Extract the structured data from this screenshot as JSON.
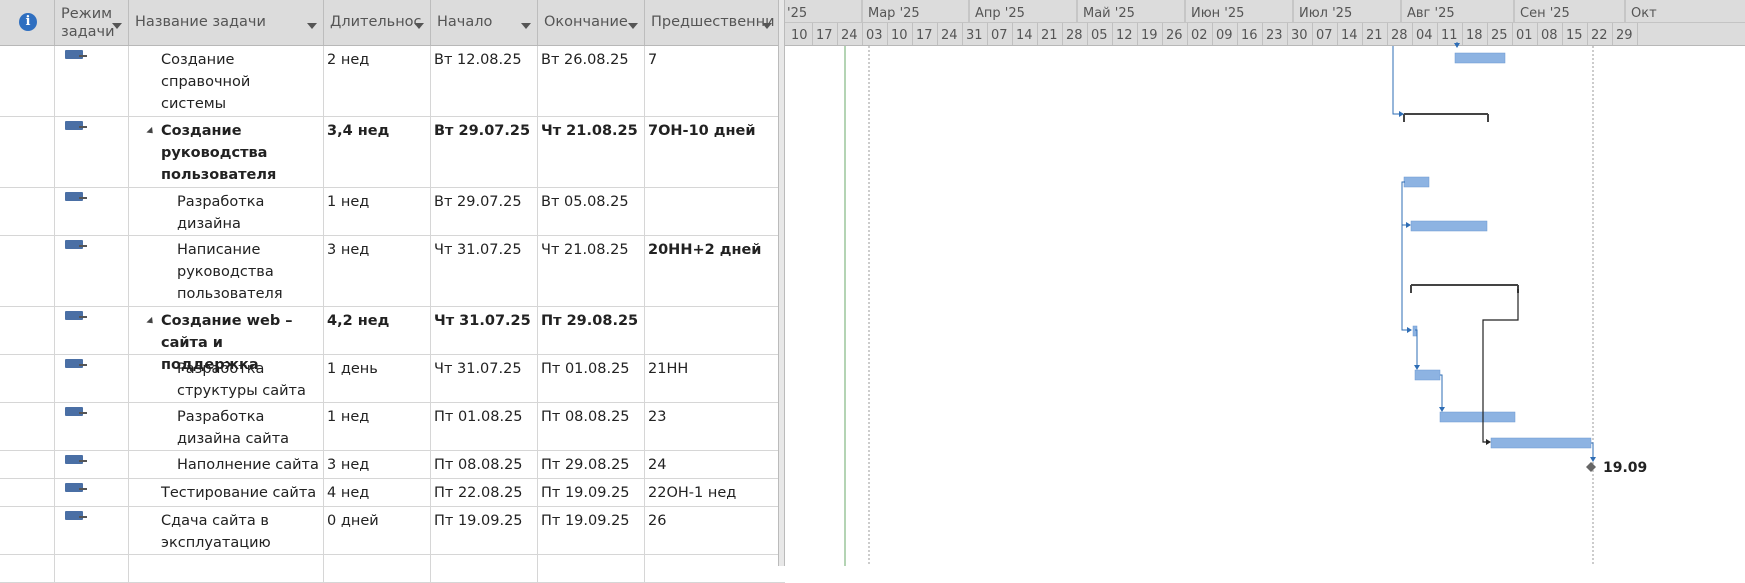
{
  "header": {
    "info_icon": "i",
    "mode_label_1": "Режим",
    "mode_label_2": "задачи",
    "name_label": "Название задачи",
    "duration_label": "Длительнос",
    "start_label": "Начало",
    "finish_label": "Окончание",
    "pred_label": "Предшественни"
  },
  "timeline": {
    "months": [
      "'25",
      "Мар '25",
      "Апр '25",
      "Май '25",
      "Июн '25",
      "Июл '25",
      "Авг '25",
      "Сен '25",
      "Окт"
    ],
    "weeks": [
      "10",
      "17",
      "24",
      "03",
      "10",
      "17",
      "24",
      "31",
      "07",
      "14",
      "21",
      "28",
      "05",
      "12",
      "19",
      "26",
      "02",
      "09",
      "16",
      "23",
      "30",
      "07",
      "14",
      "21",
      "28",
      "04",
      "11",
      "18",
      "25",
      "01",
      "08",
      "15",
      "22",
      "29"
    ]
  },
  "tasks": [
    {
      "name_lines": [
        "Создание",
        "справочной",
        "системы"
      ],
      "duration": "2 нед",
      "start": "Вт 12.08.25",
      "finish": "Вт 26.08.25",
      "pred": "7",
      "summary": false,
      "indent": 1
    },
    {
      "name_lines": [
        "Создание",
        "руководства",
        "пользователя"
      ],
      "duration": "3,4 нед",
      "start": "Вт 29.07.25",
      "finish": "Чт 21.08.25",
      "pred": "7ОН-10 дней",
      "summary": true,
      "indent": 1
    },
    {
      "name_lines": [
        "Разработка",
        "дизайна"
      ],
      "duration": "1 нед",
      "start": "Вт 29.07.25",
      "finish": "Вт 05.08.25",
      "pred": "",
      "summary": false,
      "indent": 2
    },
    {
      "name_lines": [
        "Написание",
        "руководства",
        "пользователя"
      ],
      "duration": "3 нед",
      "start": "Чт 31.07.25",
      "finish": "Чт 21.08.25",
      "pred": "20НН+2 дней",
      "pred_bold": true,
      "summary": false,
      "indent": 2
    },
    {
      "name_lines": [
        "Создание web –",
        "сайта и поддержка"
      ],
      "duration": "4,2 нед",
      "start": "Чт 31.07.25",
      "finish": "Пт 29.08.25",
      "pred": "",
      "summary": true,
      "indent": 1
    },
    {
      "name_lines": [
        "Разработка",
        "структуры сайта"
      ],
      "duration": "1 день",
      "start": "Чт 31.07.25",
      "finish": "Пт 01.08.25",
      "pred": "21НН",
      "summary": false,
      "indent": 2
    },
    {
      "name_lines": [
        "Разработка",
        "дизайна сайта"
      ],
      "duration": "1 нед",
      "start": "Пт 01.08.25",
      "finish": "Пт 08.08.25",
      "pred": "23",
      "summary": false,
      "indent": 2
    },
    {
      "name_lines": [
        "Наполнение сайта"
      ],
      "duration": "3 нед",
      "start": "Пт 08.08.25",
      "finish": "Пт 29.08.25",
      "pred": "24",
      "summary": false,
      "indent": 2
    },
    {
      "name_lines": [
        "Тестирование сайта"
      ],
      "duration": "4 нед",
      "start": "Пт 22.08.25",
      "finish": "Пт 19.09.25",
      "pred": "22ОН-1 нед",
      "summary": false,
      "indent": 1
    },
    {
      "name_lines": [
        "Сдача сайта в",
        "эксплуатацию"
      ],
      "duration": "0 дней",
      "start": "Пт 19.09.25",
      "finish": "Пт 19.09.25",
      "pred": "26",
      "summary": false,
      "indent": 1
    }
  ],
  "milestone_label": "19.09",
  "colors": {
    "bar": "#8db3e2",
    "bar_border": "#6a98d0",
    "link": "#2e6db5",
    "summary": "#444444",
    "header_bg": "#dcdcdc"
  }
}
